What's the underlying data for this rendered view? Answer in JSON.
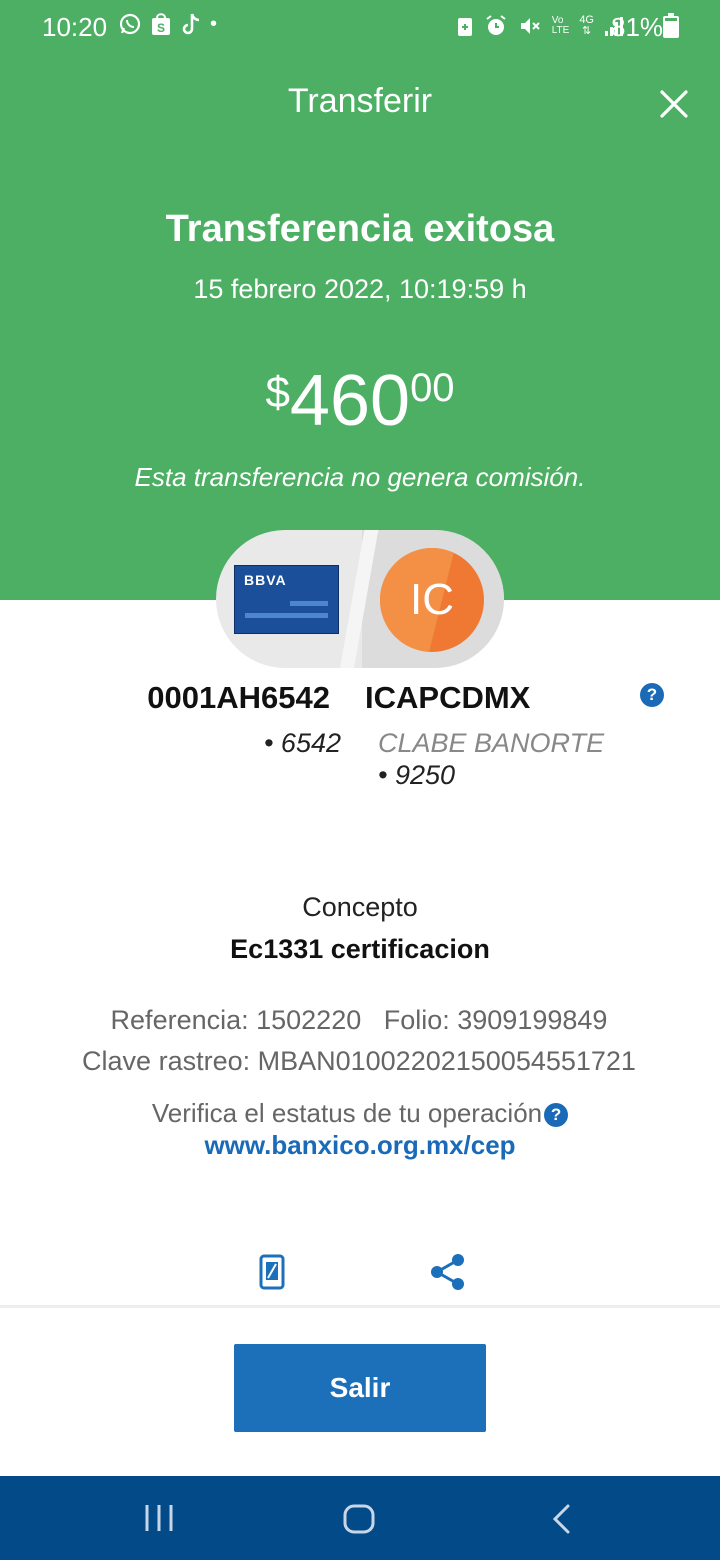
{
  "status_bar": {
    "time": "10:20",
    "battery_percent": "81%",
    "battery_level": 0.81,
    "lte_label": "LTE",
    "vo_label": "Vo",
    "network_label": "4G",
    "dot": "•"
  },
  "header": {
    "title": "Transferir"
  },
  "result": {
    "title": "Transferencia exitosa",
    "datetime": "15 febrero 2022, 10:19:59 h",
    "currency": "$",
    "amount_integer": "460",
    "amount_decimal": "00",
    "fee_note": "Esta transferencia no genera comisión."
  },
  "origin": {
    "bank_logo_text": "BBVA",
    "account_id": "0001AH6542",
    "account_last": "• 6542"
  },
  "destination": {
    "avatar_initials": "IC",
    "name": "ICAPCDMX",
    "account_type": "CLABE BANORTE",
    "account_last": "• 9250"
  },
  "details": {
    "concept_label": "Concepto",
    "concept_value": "Ec1331 certificacion",
    "reference_line": "Referencia: 1502220   Folio: 3909199849",
    "tracking_line": "Clave rastreo: MBAN01002202150054551721",
    "verify_text": "Verifica el estatus de tu operación",
    "verify_link": "www.banxico.org.mx/cep",
    "help_glyph": "?"
  },
  "actions": {
    "exit_label": "Salir"
  },
  "colors": {
    "header_green": "#4caf64",
    "primary_blue": "#1c6fb9",
    "nav_bar": "#034a88",
    "avatar_orange": "#ef7833"
  },
  "icons": [
    "whatsapp-icon",
    "shop-icon",
    "tiktok-icon",
    "alarm-icon",
    "mute-icon",
    "signal-icon",
    "battery-icon",
    "close-icon",
    "help-icon",
    "phone-icon",
    "share-icon",
    "recent-apps-icon",
    "home-icon",
    "back-icon"
  ]
}
